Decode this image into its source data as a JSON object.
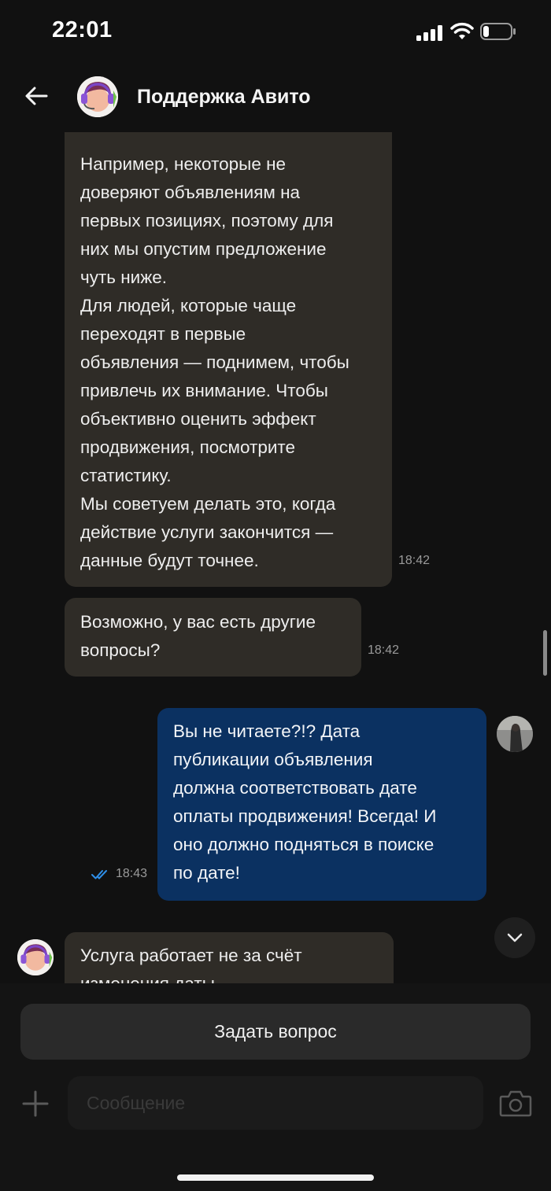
{
  "status_bar": {
    "time": "22:01"
  },
  "header": {
    "title": "Поддержка Авито",
    "avatar": "support-avatar"
  },
  "messages": [
    {
      "side": "in",
      "text": "Например, некоторые не\nдоверяют объявлениям на\nпервых позициях, поэтому для\nних мы опустим предложение\nчуть ниже.\nДля людей, которые чаще\nпереходят в первые\nобъявления — поднимем, чтобы\nпривлечь их внимание. Чтобы\nобъективно оценить эффект\nпродвижения, посмотрите\nстатистику.\nМы советуем делать это, когда\nдействие услуги закончится —\nданные будут точнее.",
      "time": "18:42"
    },
    {
      "side": "in",
      "text": "Возможно, у вас есть другие\nвопросы?",
      "time": "18:42"
    },
    {
      "side": "out",
      "text": "Вы не читаете?!? Дата\nпубликации объявления\nдолжна соответствовать дате\nоплаты продвижения! Всегда! И\nоно должно подняться в поиске\nпо дате!",
      "time": "18:43",
      "status": "read"
    },
    {
      "side": "in",
      "text": "Услуга работает не за счёт\nизменения даты",
      "time": ""
    }
  ],
  "bottom": {
    "ask_button": "Задать вопрос",
    "input_placeholder": "Сообщение"
  },
  "colors": {
    "background": "#111111",
    "incoming_bubble": "#2f2c27",
    "outgoing_bubble": "#0b3161",
    "read_ticks": "#2f8fe8"
  },
  "icons": [
    "back-arrow-icon",
    "signal-icon",
    "wifi-icon",
    "battery-icon",
    "chevron-down-icon",
    "plus-icon",
    "camera-icon",
    "double-check-icon"
  ]
}
